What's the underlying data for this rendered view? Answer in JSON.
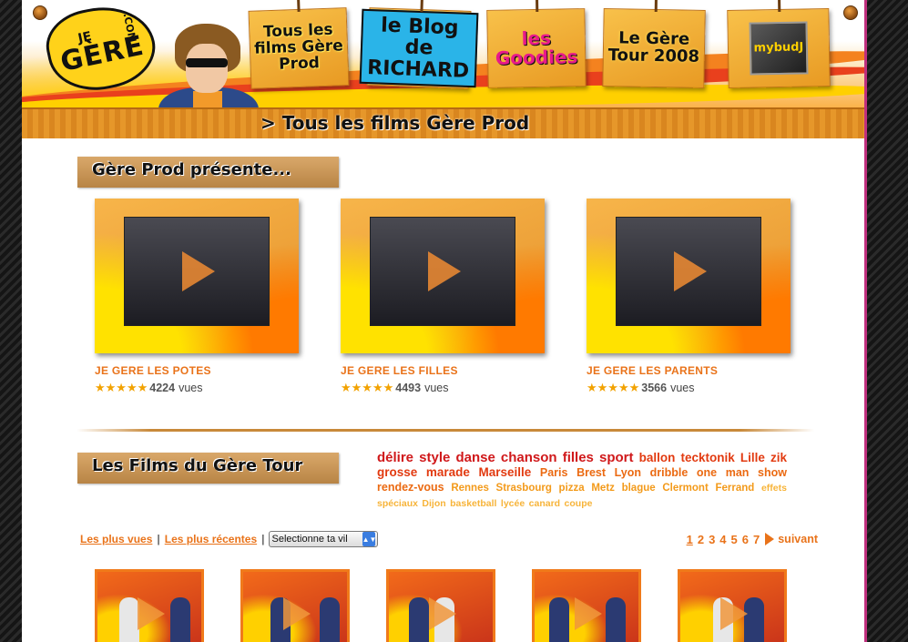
{
  "header": {
    "logo_line1": "JE",
    "logo_line2": "GÈRE",
    "logo_line3": ".COM",
    "nav": [
      {
        "label": "Tous les films Gère Prod"
      },
      {
        "label": "le Blog de RICHARD"
      },
      {
        "label": "les Goodies"
      },
      {
        "label": "Le Gère Tour 2008"
      },
      {
        "label": "mybudJ"
      }
    ],
    "breadcrumb": "> Tous les films Gère Prod"
  },
  "presente": {
    "title": "Gère Prod présente...",
    "films": [
      {
        "title": "JE GERE LES POTES",
        "rating": 5,
        "stars": "★★★★★",
        "views": "4224",
        "views_label": "vues"
      },
      {
        "title": "JE GERE LES FILLES",
        "rating": 5,
        "stars": "★★★★★",
        "views": "4493",
        "views_label": "vues"
      },
      {
        "title": "JE GERE LES PARENTS",
        "rating": 5,
        "stars": "★★★★★",
        "views": "3566",
        "views_label": "vues"
      }
    ]
  },
  "tour": {
    "title": "Les Films du Gère Tour",
    "tags": [
      {
        "text": "délire",
        "level": 1
      },
      {
        "text": "style",
        "level": 1
      },
      {
        "text": "danse",
        "level": 1
      },
      {
        "text": "chanson",
        "level": 1
      },
      {
        "text": "filles",
        "level": 1
      },
      {
        "text": "sport",
        "level": 1
      },
      {
        "text": "ballon",
        "level": 2
      },
      {
        "text": "tecktonik",
        "level": 2
      },
      {
        "text": "Lille",
        "level": 2
      },
      {
        "text": "zik",
        "level": 2
      },
      {
        "text": "grosse",
        "level": 2
      },
      {
        "text": "marade",
        "level": 2
      },
      {
        "text": "Marseille",
        "level": 2
      },
      {
        "text": "Paris",
        "level": 3
      },
      {
        "text": "Brest",
        "level": 3
      },
      {
        "text": "Lyon",
        "level": 3
      },
      {
        "text": "dribble",
        "level": 3
      },
      {
        "text": "one",
        "level": 3
      },
      {
        "text": "man",
        "level": 3
      },
      {
        "text": "show",
        "level": 3
      },
      {
        "text": "rendez-vous",
        "level": 3
      },
      {
        "text": "Rennes",
        "level": 4
      },
      {
        "text": "Strasbourg",
        "level": 4
      },
      {
        "text": "pizza",
        "level": 4
      },
      {
        "text": "Metz",
        "level": 4
      },
      {
        "text": "blague",
        "level": 4
      },
      {
        "text": "Clermont",
        "level": 4
      },
      {
        "text": "Ferrand",
        "level": 4
      },
      {
        "text": "effets",
        "level": 5
      },
      {
        "text": "spéciaux",
        "level": 5
      },
      {
        "text": "Dijon",
        "level": 5
      },
      {
        "text": "basketball",
        "level": 5
      },
      {
        "text": "lycée",
        "level": 5
      },
      {
        "text": "canard",
        "level": 5
      },
      {
        "text": "coupe",
        "level": 5
      }
    ],
    "sort_most_viewed": "Les plus vues",
    "sort_most_recent": "Les plus récentes",
    "separator": "|",
    "city_select": "Selectionne ta vil",
    "pages": [
      "1",
      "2",
      "3",
      "4",
      "5",
      "6",
      "7"
    ],
    "current_page": "1",
    "next_label": "suivant",
    "thumbnails": 5
  },
  "colors": {
    "accent_orange": "#e9731a",
    "tag_red": "#d0181a",
    "star": "#f2a200",
    "page_border": "#c0307e"
  }
}
